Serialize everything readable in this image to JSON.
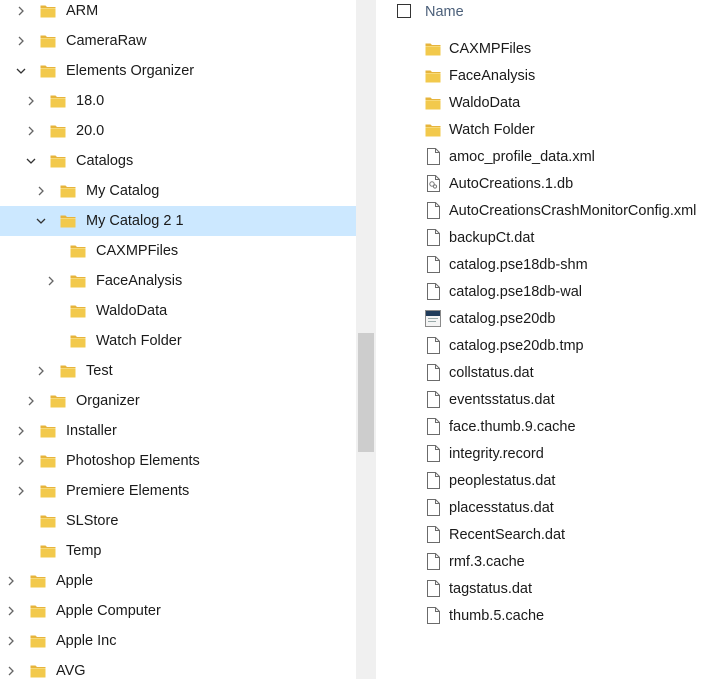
{
  "tree": [
    {
      "label": "ARM",
      "level": 2,
      "expander": "collapsed"
    },
    {
      "label": "CameraRaw",
      "level": 2,
      "expander": "collapsed"
    },
    {
      "label": "Elements Organizer",
      "level": 2,
      "expander": "expanded"
    },
    {
      "label": "18.0",
      "level": 3,
      "expander": "collapsed"
    },
    {
      "label": "20.0",
      "level": 3,
      "expander": "collapsed"
    },
    {
      "label": "Catalogs",
      "level": 3,
      "expander": "expanded"
    },
    {
      "label": "My Catalog",
      "level": 4,
      "expander": "collapsed"
    },
    {
      "label": "My Catalog 2 1",
      "level": 4,
      "expander": "expanded",
      "selected": true
    },
    {
      "label": "CAXMPFiles",
      "level": 5,
      "expander": "none"
    },
    {
      "label": "FaceAnalysis",
      "level": 5,
      "expander": "collapsed"
    },
    {
      "label": "WaldoData",
      "level": 5,
      "expander": "none"
    },
    {
      "label": "Watch Folder",
      "level": 5,
      "expander": "none"
    },
    {
      "label": "Test",
      "level": 4,
      "expander": "collapsed"
    },
    {
      "label": "Organizer",
      "level": 3,
      "expander": "collapsed"
    },
    {
      "label": "Installer",
      "level": 2,
      "expander": "collapsed"
    },
    {
      "label": "Photoshop Elements",
      "level": 2,
      "expander": "collapsed"
    },
    {
      "label": "Premiere Elements",
      "level": 2,
      "expander": "collapsed"
    },
    {
      "label": "SLStore",
      "level": 2,
      "expander": "none"
    },
    {
      "label": "Temp",
      "level": 2,
      "expander": "none"
    },
    {
      "label": "Apple",
      "level": 1,
      "expander": "collapsed"
    },
    {
      "label": "Apple Computer",
      "level": 1,
      "expander": "collapsed"
    },
    {
      "label": "Apple Inc",
      "level": 1,
      "expander": "collapsed"
    },
    {
      "label": "AVG",
      "level": 1,
      "expander": "collapsed"
    }
  ],
  "list": {
    "column_name": "Name",
    "items": [
      {
        "name": "CAXMPFiles",
        "icon": "folder-icon"
      },
      {
        "name": "FaceAnalysis",
        "icon": "folder-icon"
      },
      {
        "name": "WaldoData",
        "icon": "folder-icon"
      },
      {
        "name": "Watch Folder",
        "icon": "folder-icon"
      },
      {
        "name": "amoc_profile_data.xml",
        "icon": "file-icon"
      },
      {
        "name": "AutoCreations.1.db",
        "icon": "settings-file-icon"
      },
      {
        "name": "AutoCreationsCrashMonitorConfig.xml",
        "icon": "file-icon"
      },
      {
        "name": "backupCt.dat",
        "icon": "file-icon"
      },
      {
        "name": "catalog.pse18db-shm",
        "icon": "file-icon"
      },
      {
        "name": "catalog.pse18db-wal",
        "icon": "file-icon"
      },
      {
        "name": "catalog.pse20db",
        "icon": "catalog-file-icon"
      },
      {
        "name": "catalog.pse20db.tmp",
        "icon": "file-icon"
      },
      {
        "name": "collstatus.dat",
        "icon": "file-icon"
      },
      {
        "name": "eventsstatus.dat",
        "icon": "file-icon"
      },
      {
        "name": "face.thumb.9.cache",
        "icon": "file-icon"
      },
      {
        "name": "integrity.record",
        "icon": "file-icon"
      },
      {
        "name": "peoplestatus.dat",
        "icon": "file-icon"
      },
      {
        "name": "placesstatus.dat",
        "icon": "file-icon"
      },
      {
        "name": "RecentSearch.dat",
        "icon": "file-icon"
      },
      {
        "name": "rmf.3.cache",
        "icon": "file-icon"
      },
      {
        "name": "tagstatus.dat",
        "icon": "file-icon"
      },
      {
        "name": "thumb.5.cache",
        "icon": "file-icon"
      }
    ]
  },
  "colors": {
    "folder": "#f2c94c",
    "folder_back": "#e6b43c",
    "selection": "#cce8ff",
    "header_text": "#4c607a"
  }
}
